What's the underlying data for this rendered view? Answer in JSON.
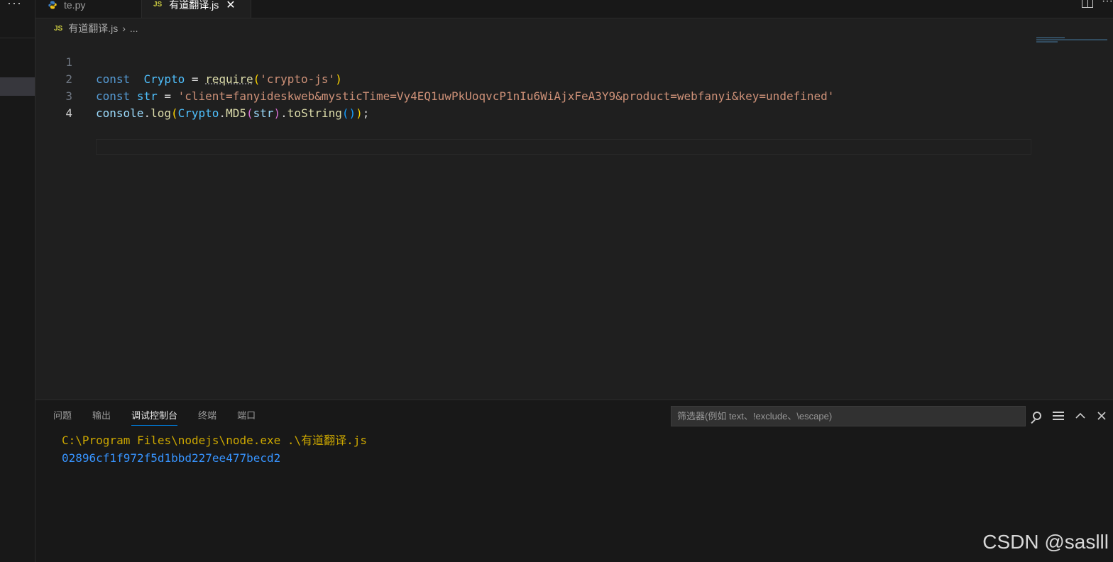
{
  "sidebar": {
    "more_label": "···"
  },
  "tabs": [
    {
      "label": "te.py",
      "icon": "python-icon"
    },
    {
      "label": "有道翻译.js",
      "icon": "js-icon",
      "close": "✕"
    }
  ],
  "tabbar_actions": {
    "more_label": "···"
  },
  "breadcrumb": {
    "file_badge": "JS",
    "file": "有道翻译.js",
    "sep": "›",
    "more": "..."
  },
  "editor": {
    "lines": [
      {
        "number": "1"
      },
      {
        "number": "2"
      },
      {
        "number": "3"
      },
      {
        "number": "4"
      }
    ],
    "tokens": {
      "l1_kw": "const",
      "l1_var": "Crypto",
      "l1_eq": " = ",
      "l1_fn": "require",
      "l1_open": "(",
      "l1_str": "'crypto-js'",
      "l1_close": ")",
      "l2_kw": "const",
      "l2_var": "str",
      "l2_eq": " = ",
      "l2_str": "'client=fanyideskweb&mysticTime=Vy4EQ1uwPkUoqvcP1nIu6WiAjxFeA3Y9&product=webfanyi&key=undefined'",
      "l3_obj": "console",
      "l3_dot1": ".",
      "l3_fn": "log",
      "l3_open1": "(",
      "l3_var": "Crypto",
      "l3_dot2": ".",
      "l3_fn2": "MD5",
      "l3_open2": "(",
      "l3_arg": "str",
      "l3_close2": ")",
      "l3_dot3": ".",
      "l3_fn3": "toString",
      "l3_parens": "()",
      "l3_close1": ")",
      "l3_semi": ";"
    }
  },
  "panel": {
    "tabs": [
      "问题",
      "输出",
      "调试控制台",
      "终端",
      "端口"
    ],
    "active_tab": "调试控制台",
    "filter_placeholder": "筛选器(例如 text、!exclude、\\escape)",
    "console": {
      "command": "C:\\Program Files\\nodejs\\node.exe .\\有道翻译.js",
      "output": "02896cf1f972f5d1bbd227ee477becd2"
    }
  },
  "watermark": "CSDN @saslll",
  "colors": {
    "editor_bg": "#1f1f1f",
    "keyword": "#569cd6",
    "string": "#ce9178",
    "function": "#dcdcaa",
    "console_cmd": "#cca700",
    "console_out": "#3794ff",
    "active_tab_underline": "#0078d4"
  }
}
